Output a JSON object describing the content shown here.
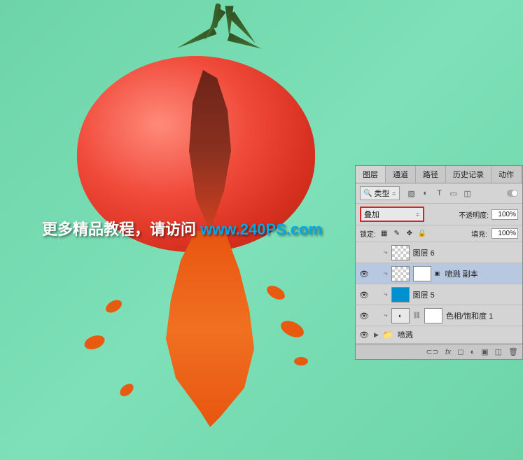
{
  "watermark": {
    "text_white": "更多精品教程，请访问 ",
    "text_blue": "www.240PS.com"
  },
  "panel": {
    "tabs": [
      "图层",
      "通道",
      "路径",
      "历史记录",
      "动作"
    ],
    "active_tab": 0,
    "filter_label": "类型",
    "blend_mode": "叠加",
    "opacity_label": "不透明度:",
    "opacity_value": "100%",
    "lock_label": "锁定:",
    "fill_label": "填充:",
    "fill_value": "100%",
    "layers": [
      {
        "name": "图层 6",
        "visible": false,
        "indented": true,
        "thumb": "checker"
      },
      {
        "name": "喷溅 副本",
        "visible": true,
        "indented": true,
        "thumb": "checker",
        "mask": true,
        "smart": true,
        "selected": true
      },
      {
        "name": "图层 5",
        "visible": true,
        "indented": true,
        "thumb": "blue"
      },
      {
        "name": "色相/饱和度 1",
        "visible": true,
        "indented": true,
        "thumb": "adj",
        "mask": true,
        "link": true
      }
    ],
    "group": {
      "name": "喷溅",
      "visible": true
    }
  }
}
